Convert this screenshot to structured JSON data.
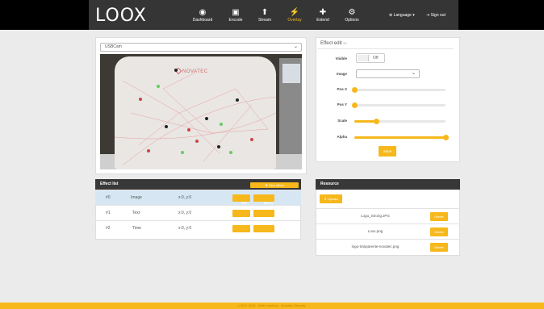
{
  "app": {
    "logo": "LOOX"
  },
  "nav": {
    "items": [
      {
        "label": "Dashboard",
        "icon": "dashboard-icon",
        "glyph": "◉"
      },
      {
        "label": "Encode",
        "icon": "image-icon",
        "glyph": "▣"
      },
      {
        "label": "Stream",
        "icon": "upload-icon",
        "glyph": "⬆"
      },
      {
        "label": "Overlay",
        "icon": "wand-icon",
        "glyph": "⚡"
      },
      {
        "label": "Extend",
        "icon": "puzzle-icon",
        "glyph": "✚"
      },
      {
        "label": "Options",
        "icon": "gears-icon",
        "glyph": "⚙"
      }
    ],
    "language": "Language",
    "signout": "Sign out",
    "accent": "#f6b81a"
  },
  "camera": {
    "source": "USBCam",
    "brand": "NOVATEC"
  },
  "effect_list": {
    "title": "Effect list",
    "new_label": "New effect",
    "edit_label": "Edit",
    "delete_label": "Delete",
    "rows": [
      {
        "id": "#0",
        "type": "Image",
        "pos": "x:0, y:0"
      },
      {
        "id": "#1",
        "type": "Text",
        "pos": "x:0, y:0"
      },
      {
        "id": "#2",
        "type": "Time",
        "pos": "x:0, y:0"
      }
    ]
  },
  "effect_edit": {
    "title": "Effect edit",
    "subtitle": "#0",
    "visible_label": "Visible",
    "visible_value": "Off",
    "image_label": "Image",
    "image_value": "",
    "posx_label": "Pos X",
    "posx_value": 0,
    "posy_label": "Pos Y",
    "posy_value": 0,
    "scale_label": "Scale",
    "scale_value": 0.24,
    "alpha_label": "Alpha",
    "alpha_value": 1.0,
    "save_label": "Save"
  },
  "resource": {
    "title": "Resource",
    "upload_label": "Upload",
    "delete_label": "Delete",
    "files": [
      "Logo_Strong.JPG",
      "Loxx.png",
      "logo-trasparente-novatec.png"
    ]
  },
  "footer": {
    "text": "LOOX 2016 - Web Interface - Novatec Security"
  }
}
